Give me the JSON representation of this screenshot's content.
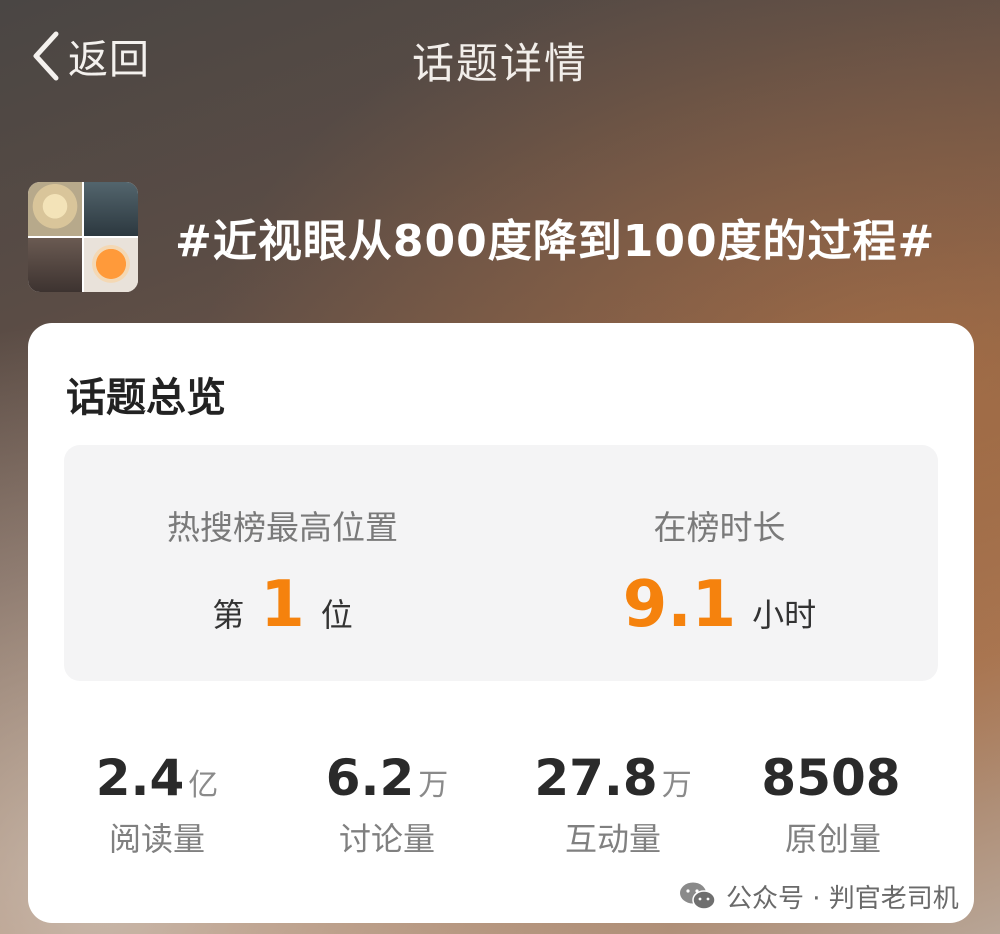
{
  "nav": {
    "back_label": "返回",
    "title": "话题详情"
  },
  "topic": {
    "title": "#近视眼从800度降到100度的过程#"
  },
  "overview": {
    "title": "话题总览",
    "rank": {
      "label": "热搜榜最高位置",
      "prefix": "第",
      "value": "1",
      "suffix": "位"
    },
    "duration": {
      "label": "在榜时长",
      "value": "9.1",
      "unit": "小时"
    },
    "metrics": [
      {
        "value": "2.4",
        "unit": "亿",
        "label": "阅读量"
      },
      {
        "value": "6.2",
        "unit": "万",
        "label": "讨论量"
      },
      {
        "value": "27.8",
        "unit": "万",
        "label": "互动量"
      },
      {
        "value": "8508",
        "unit": "",
        "label": "原创量"
      }
    ]
  },
  "watermark": {
    "text": "公众号 · 判官老司机",
    "icon": "wechat-icon"
  },
  "colors": {
    "accent": "#f5820d",
    "card_bg": "#ffffff",
    "stat_box_bg": "#f4f4f5"
  }
}
